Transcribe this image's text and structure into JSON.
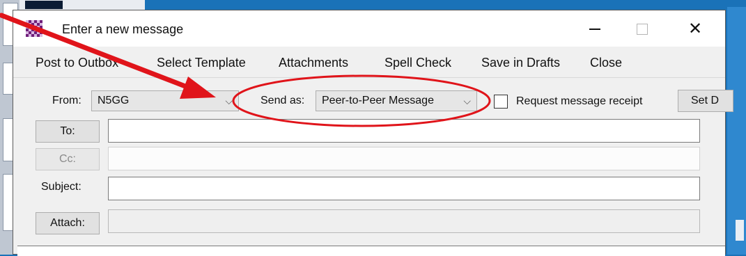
{
  "window": {
    "title": "Enter a new message"
  },
  "titlebar_buttons": {
    "minimize_icon": "minimize-icon",
    "maximize_icon": "maximize-icon",
    "close_glyph": "✕"
  },
  "menu": {
    "items": [
      {
        "label": "Post to Outbox"
      },
      {
        "label": "Select Template"
      },
      {
        "label": "Attachments"
      },
      {
        "label": "Spell Check"
      },
      {
        "label": "Save in Drafts"
      },
      {
        "label": "Close"
      }
    ]
  },
  "from": {
    "label": "From:",
    "value": "N5GG",
    "chevron": "⌵"
  },
  "send_as": {
    "label": "Send as:",
    "value": "Peer-to-Peer Message",
    "chevron": "⌵"
  },
  "receipt": {
    "label": "Request message receipt",
    "checked": false
  },
  "set_default": {
    "label": "Set D"
  },
  "to": {
    "label": "To:",
    "value": ""
  },
  "cc": {
    "label": "Cc:",
    "value": ""
  },
  "subject": {
    "label": "Subject:",
    "value": ""
  },
  "attach": {
    "label": "Attach:",
    "value": ""
  },
  "annotation": {
    "color": "#e0141a",
    "arrow_icon": "arrow-annotation-icon",
    "highlight_icon": "ellipse-annotation-icon"
  }
}
